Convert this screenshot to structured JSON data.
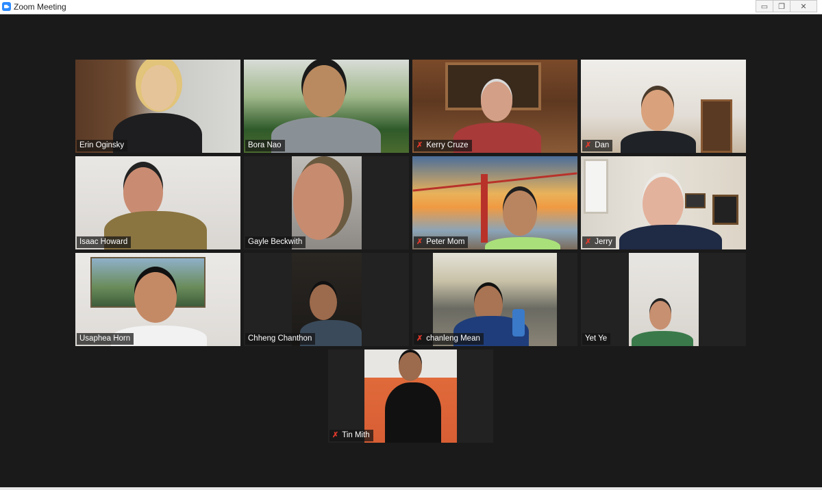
{
  "window": {
    "title": "Zoom Meeting",
    "controls": {
      "minimize": "▭",
      "restore": "❐",
      "close": "✕"
    }
  },
  "colors": {
    "active_speaker_border": "#c5dc5c",
    "muted_icon": "#e0392b",
    "stage_bg": "#1a1a1a"
  },
  "participants": [
    {
      "name": "Erin Oginsky",
      "muted": false,
      "active": true
    },
    {
      "name": "Bora Nao",
      "muted": false,
      "active": false
    },
    {
      "name": "Kerry Cruze",
      "muted": true,
      "active": false
    },
    {
      "name": "Dan",
      "muted": true,
      "active": false
    },
    {
      "name": "Isaac Howard",
      "muted": false,
      "active": false
    },
    {
      "name": "Gayle Beckwith",
      "muted": false,
      "active": false
    },
    {
      "name": "Peter Mom",
      "muted": true,
      "active": false
    },
    {
      "name": "Jerry",
      "muted": true,
      "active": false
    },
    {
      "name": "Usaphea Horn",
      "muted": false,
      "active": false
    },
    {
      "name": "Chheng Chanthon",
      "muted": false,
      "active": false
    },
    {
      "name": "chanleng Mean",
      "muted": true,
      "active": false
    },
    {
      "name": "Yet Ye",
      "muted": false,
      "active": false
    },
    {
      "name": "Tin Mith",
      "muted": true,
      "active": false
    }
  ],
  "icons": {
    "muted_mic": "muted-mic-icon",
    "app": "zoom-app-icon"
  }
}
